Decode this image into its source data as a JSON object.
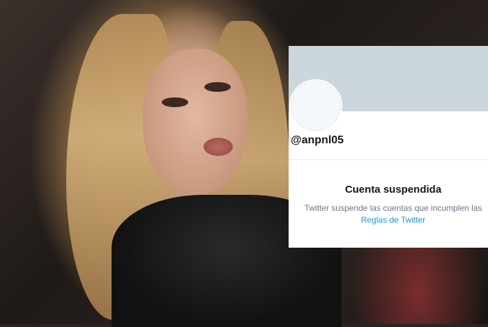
{
  "profile": {
    "handle": "@anpnl05",
    "banner_color": "#ccd6dd"
  },
  "suspension": {
    "title": "Cuenta suspendida",
    "description": "Twitter suspende las cuentas que incumplen las",
    "link_label": "Reglas de Twitter",
    "link_color": "#1b95e0"
  }
}
